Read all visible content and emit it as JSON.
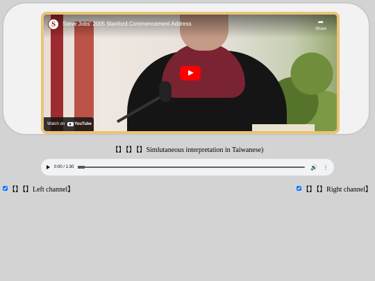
{
  "video": {
    "channel_logo": "S",
    "title": "Steve Jobs' 2005 Stanford Commencement Address",
    "share_label": "Share",
    "watch_on": "Watch on",
    "youtube": "YouTube",
    "accent": "#ff0000",
    "border_color": "#e9c474"
  },
  "caption": "【】【】【】Simlutaneous interpretation in Taiwanese)",
  "audio": {
    "time": "0:00 / 1:30",
    "progress_fraction": 0
  },
  "channels": {
    "left_label": "【】【】Left channel】",
    "right_label": "【】【】Right channel】",
    "left_checked": true,
    "right_checked": true
  },
  "icons": {
    "share": "share-icon",
    "play": "play-icon",
    "volume": "volume-icon",
    "more": "more-options-icon"
  }
}
